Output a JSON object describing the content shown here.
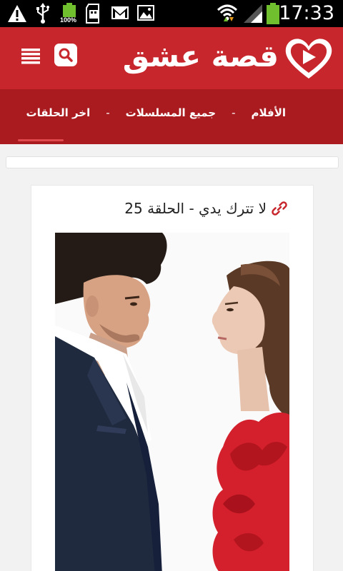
{
  "status_bar": {
    "time": "17:33",
    "battery_percent": "100%",
    "icons": [
      "warning-icon",
      "usb-icon",
      "battery-full-icon",
      "sd-card-icon",
      "gmail-icon",
      "image-icon",
      "wifi-icon",
      "signal-icon",
      "battery-icon"
    ]
  },
  "header": {
    "logo_text": "قصة عشق",
    "logo_icon": "heart-play-icon",
    "search_icon": "search-icon",
    "menu_icon": "menu-icon",
    "brand_color": "#c6262c"
  },
  "nav": {
    "items": [
      {
        "label": "اخر الحلقات"
      },
      {
        "label": "جميع المسلسلات"
      },
      {
        "label": "الأفلام"
      }
    ],
    "separator": "-",
    "bar_color": "#a91b1f"
  },
  "post": {
    "title": "لا تترك يدي - الحلقة 25",
    "link_icon": "link-icon",
    "image": "series-poster-man-and-woman"
  }
}
